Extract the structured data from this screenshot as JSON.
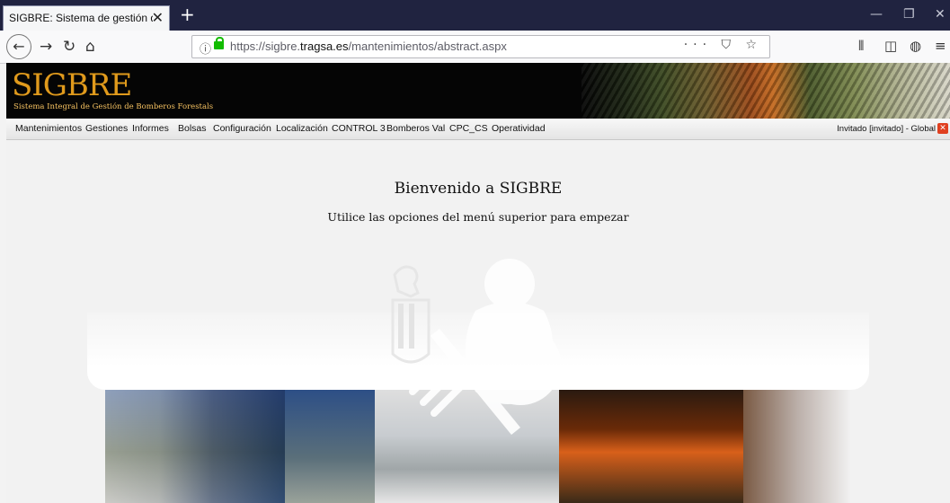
{
  "browser": {
    "tab_title": "SIGBRE: Sistema de gestión de Bom",
    "tab_close": "✕",
    "new_tab": "+",
    "url_prefix": "https://sigbre.",
    "url_domain": "tragsa.es",
    "url_path": "/mantenimientos/abstract.aspx",
    "url_actions": "··· ⛉ ☆"
  },
  "site": {
    "logo": "SIGBRE",
    "logo_subtitle": "Sistema Integral de Gestión de Bomberos Forestals"
  },
  "menu": {
    "items": [
      "Mantenimientos",
      "Gestiones",
      "Informes",
      "Bolsas",
      "Configuración",
      "Localización",
      "CONTROL 3",
      "Bomberos Val",
      "CPC_CS",
      "Operatividad"
    ],
    "user": "Invitado [invitado] - Global"
  },
  "main": {
    "title": "Bienvenido a SIGBRE",
    "subtitle": "Utilice las opciones del menú superior para empezar"
  },
  "colors": {
    "tabstrip": "#202340",
    "logo": "#e09a1c",
    "lock": "#12bc00",
    "logout": "#e04020"
  }
}
